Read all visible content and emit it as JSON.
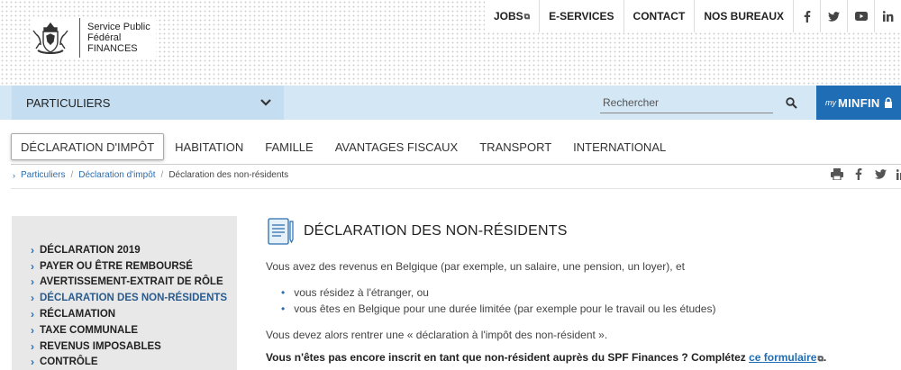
{
  "header": {
    "logo_lines": [
      "Service Public",
      "Fédéral",
      "FINANCES"
    ],
    "topnav": [
      {
        "label": "JOBS",
        "external": true
      },
      {
        "label": "E-SERVICES",
        "external": false
      },
      {
        "label": "CONTACT",
        "external": false
      },
      {
        "label": "NOS BUREAUX",
        "external": false
      }
    ],
    "social_icons": [
      "facebook-icon",
      "twitter-icon",
      "youtube-icon",
      "linkedin-icon"
    ]
  },
  "bluebar": {
    "audience_selected": "PARTICULIERS",
    "search_placeholder": "Rechercher",
    "myminfin_prefix": "my",
    "myminfin_label": "MINFIN"
  },
  "tabs": [
    {
      "label": "DÉCLARATION D'IMPÔT",
      "active": true
    },
    {
      "label": "HABITATION",
      "active": false
    },
    {
      "label": "FAMILLE",
      "active": false
    },
    {
      "label": "AVANTAGES FISCAUX",
      "active": false
    },
    {
      "label": "TRANSPORT",
      "active": false
    },
    {
      "label": "INTERNATIONAL",
      "active": false
    }
  ],
  "breadcrumb": [
    "Particuliers",
    "Déclaration d'impôt",
    "Déclaration des non-résidents"
  ],
  "sidebar": {
    "items": [
      {
        "label": "DÉCLARATION 2019",
        "active": false
      },
      {
        "label": "PAYER OU ÊTRE REMBOURSÉ",
        "active": false
      },
      {
        "label": "AVERTISSEMENT-EXTRAIT DE RÔLE",
        "active": false
      },
      {
        "label": "DÉCLARATION DES NON-RÉSIDENTS",
        "active": true
      },
      {
        "label": "RÉCLAMATION",
        "active": false
      },
      {
        "label": "TAXE COMMUNALE",
        "active": false
      },
      {
        "label": "REVENUS IMPOSABLES",
        "active": false
      },
      {
        "label": "CONTRÔLE",
        "active": false
      }
    ]
  },
  "content": {
    "title": "DÉCLARATION DES NON-RÉSIDENTS",
    "intro": "Vous avez des revenus en Belgique (par exemple, un salaire, une pension, un loyer), et",
    "bullets": [
      "vous résidez à l'étranger, ou",
      "vous êtes en Belgique pour une durée limitée (par exemple pour le travail ou les études)"
    ],
    "followup": "Vous devez alors rentrer une « déclaration à l'impôt des non-résident ».",
    "cta_text": "Vous n'êtes pas encore inscrit en tant que non-résident auprès du SPF Finances ? Complétez ",
    "cta_link": "ce formulaire",
    "cta_end": "."
  },
  "colors": {
    "bluebar": "#d4e7f5",
    "audience_bg": "#c4ddf0",
    "myminfin_bg": "#1f6eb5",
    "link": "#2a6db0",
    "sidebar_bg": "#e8e8e8"
  }
}
